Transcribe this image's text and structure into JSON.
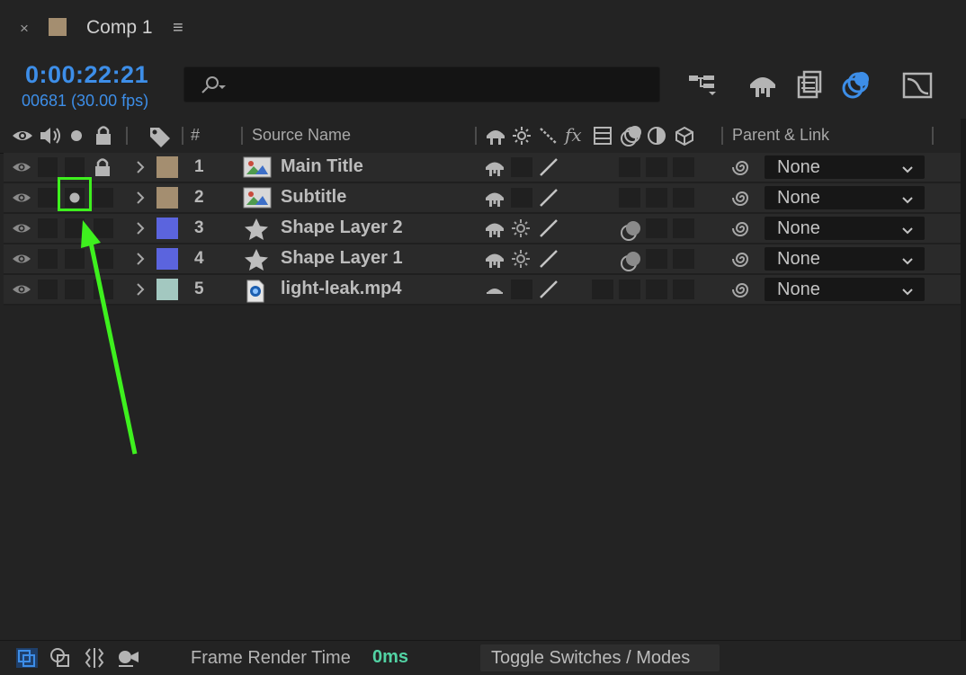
{
  "tab": {
    "close": "×",
    "title": "Comp 1",
    "menu": "≡",
    "swatch_color": "#a48e70"
  },
  "timecode": {
    "current": "0:00:22:21",
    "frames": "00681 (30.00 fps)"
  },
  "search": {
    "value": "",
    "placeholder": ""
  },
  "toolbar": [
    "shy-layers-icon",
    "draft-3d-icon",
    "frame-blending-icon",
    "motion-blur-icon",
    "graph-editor-icon"
  ],
  "columns": {
    "number": "#",
    "source_name": "Source Name",
    "parent_link": "Parent & Link",
    "fx": "fx"
  },
  "layers": [
    {
      "num": "1",
      "name": "Main Title",
      "color": "#a48e70",
      "type": "text",
      "locked": true,
      "solo": false,
      "parent": "None"
    },
    {
      "num": "2",
      "name": "Subtitle",
      "color": "#a48e70",
      "type": "text",
      "locked": false,
      "solo": true,
      "parent": "None"
    },
    {
      "num": "3",
      "name": "Shape Layer 2",
      "color": "#5b64de",
      "type": "shape",
      "locked": false,
      "solo": false,
      "parent": "None"
    },
    {
      "num": "4",
      "name": "Shape Layer 1",
      "color": "#5b64de",
      "type": "shape",
      "locked": false,
      "solo": false,
      "parent": "None"
    },
    {
      "num": "5",
      "name": "light-leak.mp4",
      "color": "#a3c8c0",
      "type": "footage",
      "locked": false,
      "solo": false,
      "parent": "None"
    }
  ],
  "footer": {
    "frame_render_label": "Frame Render Time",
    "frame_render_value": "0ms",
    "toggle_label": "Toggle Switches / Modes"
  },
  "colors": {
    "accent_blue": "#3d8ee8",
    "highlight_green": "#3ef01e",
    "render_time_green": "#52d3a4"
  }
}
